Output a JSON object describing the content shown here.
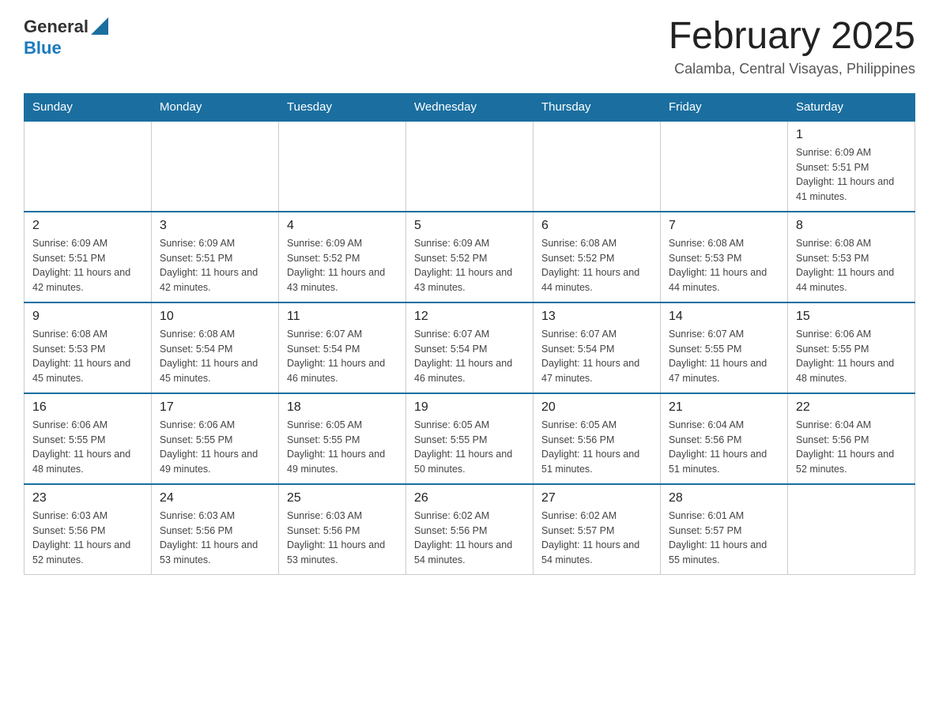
{
  "header": {
    "logo": {
      "general": "General",
      "blue": "Blue"
    },
    "title": "February 2025",
    "location": "Calamba, Central Visayas, Philippines"
  },
  "calendar": {
    "days_of_week": [
      "Sunday",
      "Monday",
      "Tuesday",
      "Wednesday",
      "Thursday",
      "Friday",
      "Saturday"
    ],
    "weeks": [
      [
        {
          "day": "",
          "info": "",
          "empty": true
        },
        {
          "day": "",
          "info": "",
          "empty": true
        },
        {
          "day": "",
          "info": "",
          "empty": true
        },
        {
          "day": "",
          "info": "",
          "empty": true
        },
        {
          "day": "",
          "info": "",
          "empty": true
        },
        {
          "day": "",
          "info": "",
          "empty": true
        },
        {
          "day": "1",
          "info": "Sunrise: 6:09 AM\nSunset: 5:51 PM\nDaylight: 11 hours and 41 minutes.",
          "empty": false
        }
      ],
      [
        {
          "day": "2",
          "info": "Sunrise: 6:09 AM\nSunset: 5:51 PM\nDaylight: 11 hours and 42 minutes.",
          "empty": false
        },
        {
          "day": "3",
          "info": "Sunrise: 6:09 AM\nSunset: 5:51 PM\nDaylight: 11 hours and 42 minutes.",
          "empty": false
        },
        {
          "day": "4",
          "info": "Sunrise: 6:09 AM\nSunset: 5:52 PM\nDaylight: 11 hours and 43 minutes.",
          "empty": false
        },
        {
          "day": "5",
          "info": "Sunrise: 6:09 AM\nSunset: 5:52 PM\nDaylight: 11 hours and 43 minutes.",
          "empty": false
        },
        {
          "day": "6",
          "info": "Sunrise: 6:08 AM\nSunset: 5:52 PM\nDaylight: 11 hours and 44 minutes.",
          "empty": false
        },
        {
          "day": "7",
          "info": "Sunrise: 6:08 AM\nSunset: 5:53 PM\nDaylight: 11 hours and 44 minutes.",
          "empty": false
        },
        {
          "day": "8",
          "info": "Sunrise: 6:08 AM\nSunset: 5:53 PM\nDaylight: 11 hours and 44 minutes.",
          "empty": false
        }
      ],
      [
        {
          "day": "9",
          "info": "Sunrise: 6:08 AM\nSunset: 5:53 PM\nDaylight: 11 hours and 45 minutes.",
          "empty": false
        },
        {
          "day": "10",
          "info": "Sunrise: 6:08 AM\nSunset: 5:54 PM\nDaylight: 11 hours and 45 minutes.",
          "empty": false
        },
        {
          "day": "11",
          "info": "Sunrise: 6:07 AM\nSunset: 5:54 PM\nDaylight: 11 hours and 46 minutes.",
          "empty": false
        },
        {
          "day": "12",
          "info": "Sunrise: 6:07 AM\nSunset: 5:54 PM\nDaylight: 11 hours and 46 minutes.",
          "empty": false
        },
        {
          "day": "13",
          "info": "Sunrise: 6:07 AM\nSunset: 5:54 PM\nDaylight: 11 hours and 47 minutes.",
          "empty": false
        },
        {
          "day": "14",
          "info": "Sunrise: 6:07 AM\nSunset: 5:55 PM\nDaylight: 11 hours and 47 minutes.",
          "empty": false
        },
        {
          "day": "15",
          "info": "Sunrise: 6:06 AM\nSunset: 5:55 PM\nDaylight: 11 hours and 48 minutes.",
          "empty": false
        }
      ],
      [
        {
          "day": "16",
          "info": "Sunrise: 6:06 AM\nSunset: 5:55 PM\nDaylight: 11 hours and 48 minutes.",
          "empty": false
        },
        {
          "day": "17",
          "info": "Sunrise: 6:06 AM\nSunset: 5:55 PM\nDaylight: 11 hours and 49 minutes.",
          "empty": false
        },
        {
          "day": "18",
          "info": "Sunrise: 6:05 AM\nSunset: 5:55 PM\nDaylight: 11 hours and 49 minutes.",
          "empty": false
        },
        {
          "day": "19",
          "info": "Sunrise: 6:05 AM\nSunset: 5:55 PM\nDaylight: 11 hours and 50 minutes.",
          "empty": false
        },
        {
          "day": "20",
          "info": "Sunrise: 6:05 AM\nSunset: 5:56 PM\nDaylight: 11 hours and 51 minutes.",
          "empty": false
        },
        {
          "day": "21",
          "info": "Sunrise: 6:04 AM\nSunset: 5:56 PM\nDaylight: 11 hours and 51 minutes.",
          "empty": false
        },
        {
          "day": "22",
          "info": "Sunrise: 6:04 AM\nSunset: 5:56 PM\nDaylight: 11 hours and 52 minutes.",
          "empty": false
        }
      ],
      [
        {
          "day": "23",
          "info": "Sunrise: 6:03 AM\nSunset: 5:56 PM\nDaylight: 11 hours and 52 minutes.",
          "empty": false
        },
        {
          "day": "24",
          "info": "Sunrise: 6:03 AM\nSunset: 5:56 PM\nDaylight: 11 hours and 53 minutes.",
          "empty": false
        },
        {
          "day": "25",
          "info": "Sunrise: 6:03 AM\nSunset: 5:56 PM\nDaylight: 11 hours and 53 minutes.",
          "empty": false
        },
        {
          "day": "26",
          "info": "Sunrise: 6:02 AM\nSunset: 5:56 PM\nDaylight: 11 hours and 54 minutes.",
          "empty": false
        },
        {
          "day": "27",
          "info": "Sunrise: 6:02 AM\nSunset: 5:57 PM\nDaylight: 11 hours and 54 minutes.",
          "empty": false
        },
        {
          "day": "28",
          "info": "Sunrise: 6:01 AM\nSunset: 5:57 PM\nDaylight: 11 hours and 55 minutes.",
          "empty": false
        },
        {
          "day": "",
          "info": "",
          "empty": true
        }
      ]
    ]
  }
}
